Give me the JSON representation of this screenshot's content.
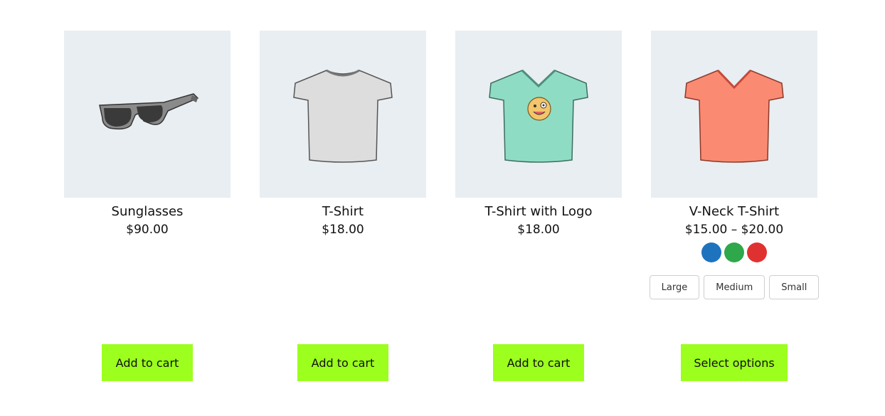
{
  "products": [
    {
      "title": "Sunglasses",
      "price": "$90.00",
      "button": "Add to cart",
      "image_icon": "sunglasses-icon"
    },
    {
      "title": "T-Shirt",
      "price": "$18.00",
      "button": "Add to cart",
      "image_icon": "tshirt-icon"
    },
    {
      "title": "T-Shirt with Logo",
      "price": "$18.00",
      "button": "Add to cart",
      "image_icon": "tshirt-logo-icon"
    },
    {
      "title": "V-Neck T-Shirt",
      "price": "$15.00 – $20.00",
      "button": "Select options",
      "image_icon": "vneck-tshirt-icon",
      "colors": [
        "#1e73be",
        "#2ea84a",
        "#e03131"
      ],
      "sizes": [
        "Large",
        "Medium",
        "Small"
      ]
    }
  ],
  "theme": {
    "button_color": "#9cff1e",
    "image_background": "#e9eef2"
  }
}
